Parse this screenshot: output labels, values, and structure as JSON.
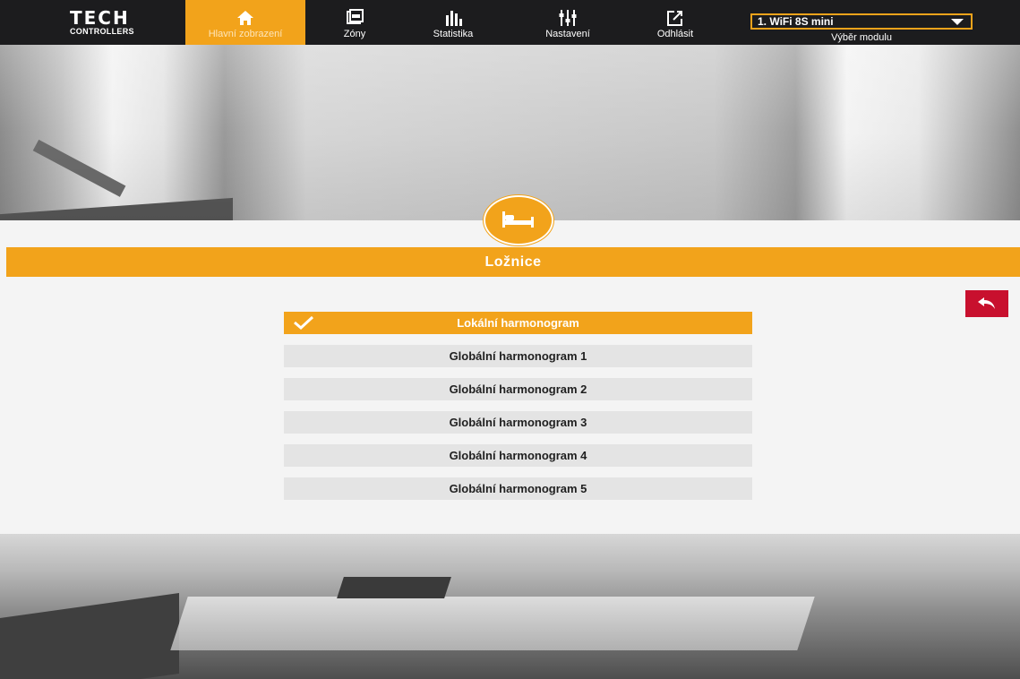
{
  "brand": {
    "logo_main": "TECH",
    "logo_sub": "CONTROLLERS"
  },
  "nav": [
    {
      "label": "Hlavní zobrazení",
      "icon": "home-icon",
      "active": true
    },
    {
      "label": "Zóny",
      "icon": "zones-icon",
      "active": false
    },
    {
      "label": "Statistika",
      "icon": "statistics-icon",
      "active": false
    },
    {
      "label": "Nastavení",
      "icon": "settings-sliders-icon",
      "active": false
    },
    {
      "label": "Odhlásit",
      "icon": "logout-icon",
      "active": false
    }
  ],
  "module": {
    "selected": "1. WiFi 8S mini",
    "caption": "Výběr modulu"
  },
  "zone": {
    "title": "Ložnice",
    "icon": "bed-icon"
  },
  "schedules": [
    {
      "label": "Lokální harmonogram",
      "selected": true
    },
    {
      "label": "Globální harmonogram 1",
      "selected": false
    },
    {
      "label": "Globální harmonogram 2",
      "selected": false
    },
    {
      "label": "Globální harmonogram 3",
      "selected": false
    },
    {
      "label": "Globální harmonogram 4",
      "selected": false
    },
    {
      "label": "Globální harmonogram 5",
      "selected": false
    }
  ],
  "colors": {
    "accent": "#f2a31b",
    "topbar": "#1c1c1e",
    "back_button": "#c8102e",
    "list_item": "#e4e4e4"
  }
}
